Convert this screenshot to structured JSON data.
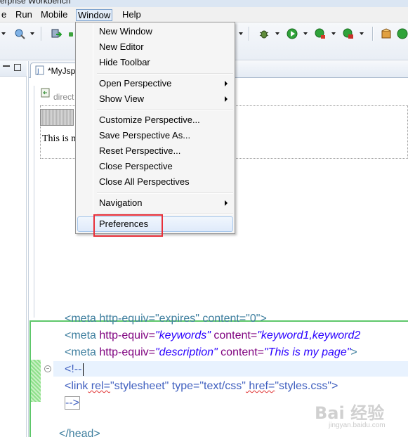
{
  "window": {
    "title": "erprise Workbench"
  },
  "menubar": {
    "items": [
      "e",
      "Run",
      "Mobile",
      "Window",
      "Help"
    ],
    "active": "Window"
  },
  "window_menu": {
    "items": [
      {
        "label": "New Window",
        "submenu": false
      },
      {
        "label": "New Editor",
        "submenu": false
      },
      {
        "label": "Hide Toolbar",
        "submenu": false
      },
      {
        "label": "Open Perspective",
        "submenu": true
      },
      {
        "label": "Show View",
        "submenu": true
      },
      {
        "label": "Customize Perspective...",
        "submenu": false
      },
      {
        "label": "Save Perspective As...",
        "submenu": false
      },
      {
        "label": "Reset Perspective...",
        "submenu": false
      },
      {
        "label": "Close Perspective",
        "submenu": false
      },
      {
        "label": "Close All Perspectives",
        "submenu": false
      },
      {
        "label": "Navigation",
        "submenu": true
      },
      {
        "label": "Preferences",
        "submenu": false,
        "highlighted": true
      }
    ]
  },
  "editor": {
    "tab_label": "*MyJsp",
    "design_dir_text": "direct",
    "design_body_text": "This is n"
  },
  "source": {
    "line1": "<meta http-equiv=\"expires\" content=\"0\">",
    "line2": {
      "tag": "<meta",
      "attr1": " http-equiv=",
      "val1": "\"keywords\"",
      "attr2": " content=",
      "val2": "\"keyword1,keyword2"
    },
    "line3": {
      "tag": "<meta",
      "attr1": " http-equiv=",
      "val1": "\"description\"",
      "attr2": " content=",
      "val2": "\"This is my page\"",
      "close": ">"
    },
    "line4": "<!--",
    "line5": {
      "tag": "<link",
      "a1": " rel=",
      "v1": "\"stylesheet\"",
      "a2": " type=",
      "v2": "\"text/css\"",
      "a3": " href=",
      "v3": "\"styles.css\"",
      "close": ">"
    },
    "line6": "-->",
    "line7": "</head>"
  },
  "watermark": {
    "big": "Bai 经验",
    "small": "jingyan.baidu.com"
  },
  "colors": {
    "highlight_box": "#e8303a",
    "source_border": "#5ec76b"
  }
}
